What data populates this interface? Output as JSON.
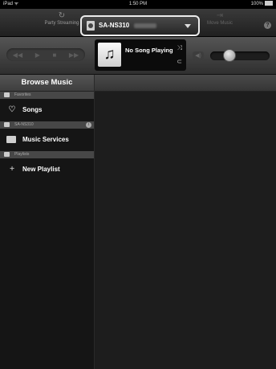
{
  "status_bar": {
    "device": "iPad ᯤ",
    "time": "1:50 PM",
    "battery": "100%"
  },
  "toolbar": {
    "party_streaming_label": "Party Streaming",
    "move_music_label": "Move Music",
    "help_glyph": "?"
  },
  "speaker": {
    "selected": "SA-NS310"
  },
  "now_playing": {
    "title": "No Song Playing"
  },
  "sidebar": {
    "title": "Browse Music",
    "sections": [
      {
        "header": "Favorites",
        "items": [
          "Songs"
        ]
      },
      {
        "header": "SA-NS310",
        "items": [
          "Music Services"
        ]
      },
      {
        "header": "Playlists",
        "items": [
          "New Playlist"
        ]
      }
    ]
  },
  "icons": {
    "party": "party-streaming-icon",
    "move": "move-music-icon",
    "prev": "previous-icon",
    "play": "play-icon",
    "stop": "stop-icon",
    "next": "next-icon",
    "music_note": "music-note-icon",
    "shuffle": "shuffle-icon",
    "repeat": "repeat-icon",
    "volume": "speaker-volume-icon",
    "heart": "heart-icon",
    "folder": "folder-icon",
    "plus": "plus-icon"
  },
  "volume": {
    "level": 0.2
  }
}
